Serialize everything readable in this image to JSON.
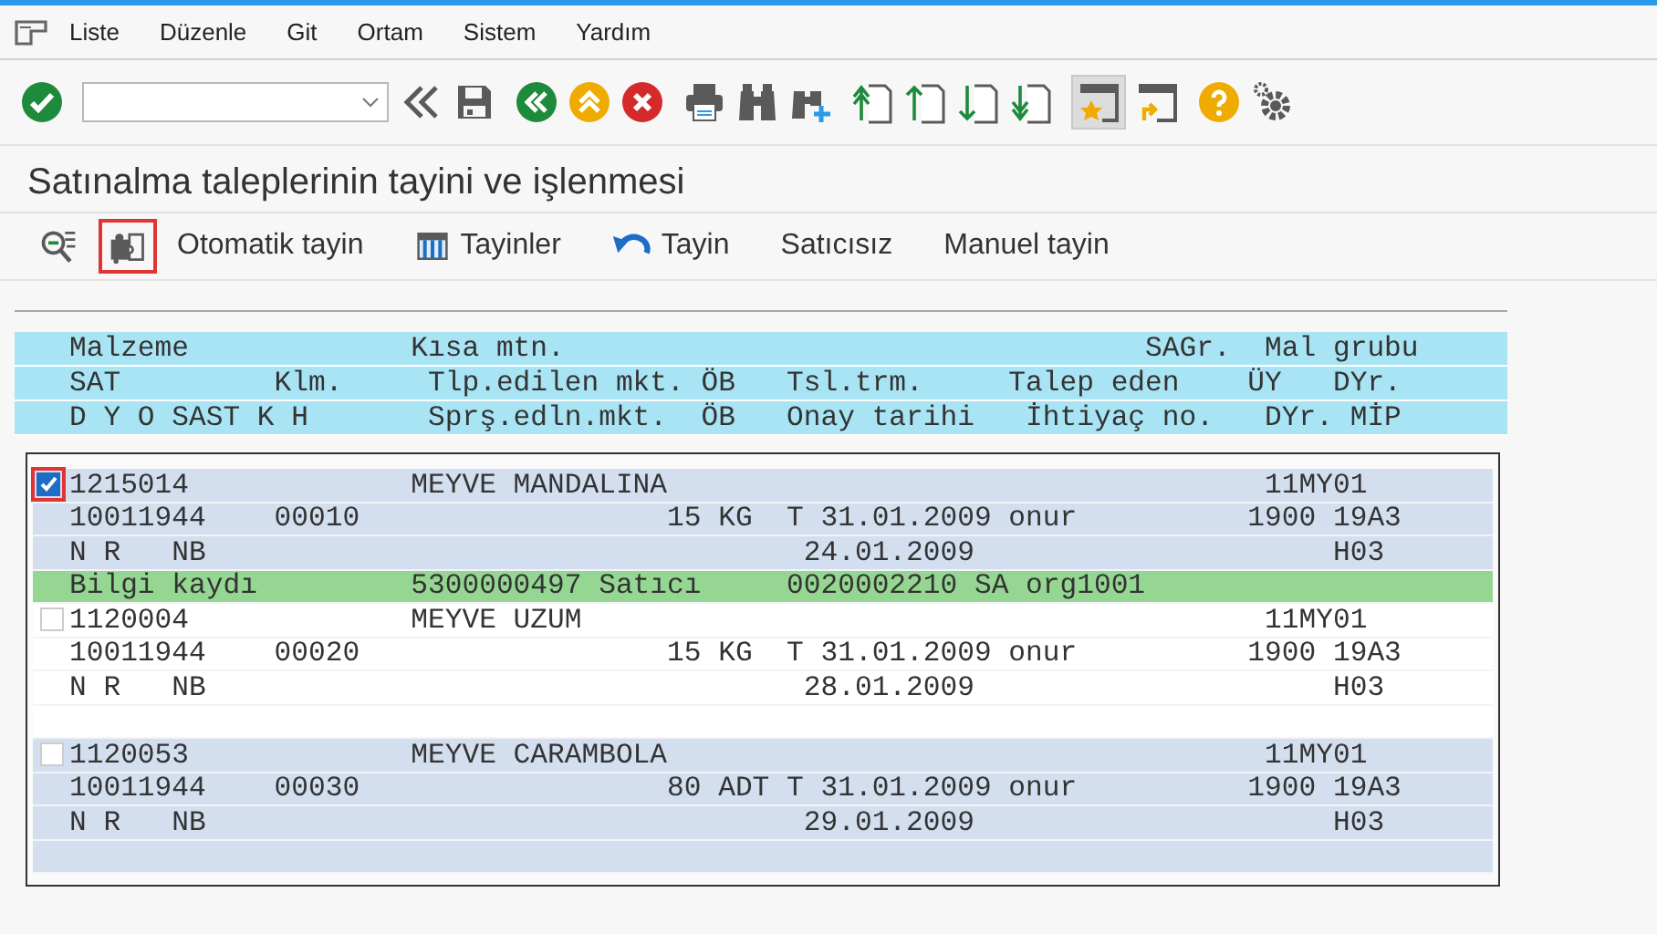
{
  "menu": [
    {
      "label": "Liste"
    },
    {
      "label": "Düzenle"
    },
    {
      "label": "Git"
    },
    {
      "label": "Ortam"
    },
    {
      "label": "Sistem"
    },
    {
      "label": "Yardım"
    }
  ],
  "title": "Satınalma taleplerinin tayini ve işlenmesi",
  "app_toolbar": [
    {
      "kind": "icon",
      "marked": false
    },
    {
      "kind": "icon",
      "marked": true
    },
    {
      "kind": "text",
      "label": "Otomatik tayin",
      "marked": false
    },
    {
      "kind": "icon_text",
      "label": "Tayinler",
      "marked": false
    },
    {
      "kind": "icon_text",
      "label": "Tayin",
      "marked": false
    },
    {
      "kind": "text",
      "label": "Satıcısız",
      "marked": false
    },
    {
      "kind": "text",
      "label": "Manuel tayin",
      "marked": false
    }
  ],
  "header_lines": [
    "Malzeme             Kısa mtn.                                  SAGr.  Mal grubu",
    "SAT         Klm.     Tlp.edilen mkt. ÖB   Tsl.trm.     Talep eden    ÜY   DYr.",
    "D Y O SAST K H       Sprş.edln.mkt.  ÖB   Onay tarihi   İhtiyaç no.   DYr. MİP"
  ],
  "items": [
    {
      "checked": true,
      "marked": true,
      "lines": [
        "1215014             MEYVE MANDALINA                                   11MY01",
        "10011944    00010                  15 KG  T 31.01.2009 onur          1900 19A3",
        "N R   NB                                   24.01.2009                     H03"
      ],
      "info": "Bilgi kaydı         5300000497 Satıcı     0020002210 SA org1001"
    },
    {
      "checked": false,
      "marked": false,
      "lines": [
        "1120004             MEYVE UZUM                                        11MY01",
        "10011944    00020                  15 KG  T 31.01.2009 onur          1900 19A3",
        "N R   NB                                   28.01.2009                     H03"
      ]
    },
    {
      "checked": false,
      "marked": false,
      "lines": [
        "1120053             MEYVE CARAMBOLA                                   11MY01",
        "10011944    00030                  80 ADT T 31.01.2009 onur          1900 19A3",
        "N R   NB                                   29.01.2009                     H03"
      ]
    }
  ]
}
